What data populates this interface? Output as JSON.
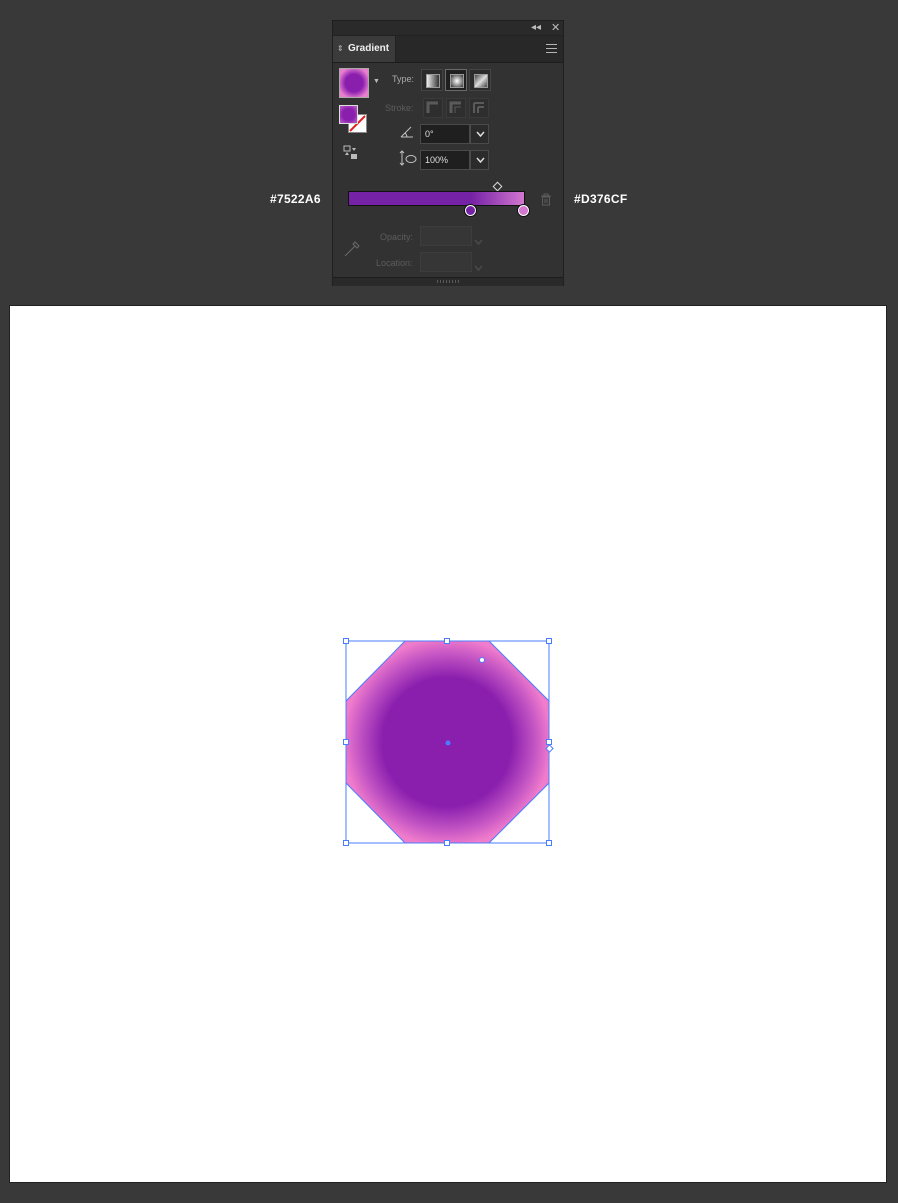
{
  "panel": {
    "title": "Gradient",
    "type_label": "Type:",
    "stroke_label": "Stroke:",
    "angle_value": "0°",
    "aspect_value": "100%",
    "opacity_label": "Opacity:",
    "location_label": "Location:",
    "type_options": [
      "linear-gradient",
      "radial-gradient",
      "freeform-gradient"
    ],
    "selected_type": "radial-gradient"
  },
  "gradient": {
    "start_color": "#7522A6",
    "end_color": "#D376CF",
    "start_label": "#7522A6",
    "end_label": "#D376CF",
    "midpoint": 0.85,
    "stops": [
      {
        "color": "#7522A6",
        "location": 0.7
      },
      {
        "color": "#D376CF",
        "location": 1.0
      }
    ]
  },
  "colors": {
    "app_background": "#393939",
    "panel_background": "#323232",
    "canvas_background": "#ffffff",
    "selection": "#4a7cff",
    "shape_center": "#8a1fae",
    "shape_edge": "#f078c8"
  },
  "canvas": {
    "shape": "octagon",
    "selected": true
  }
}
